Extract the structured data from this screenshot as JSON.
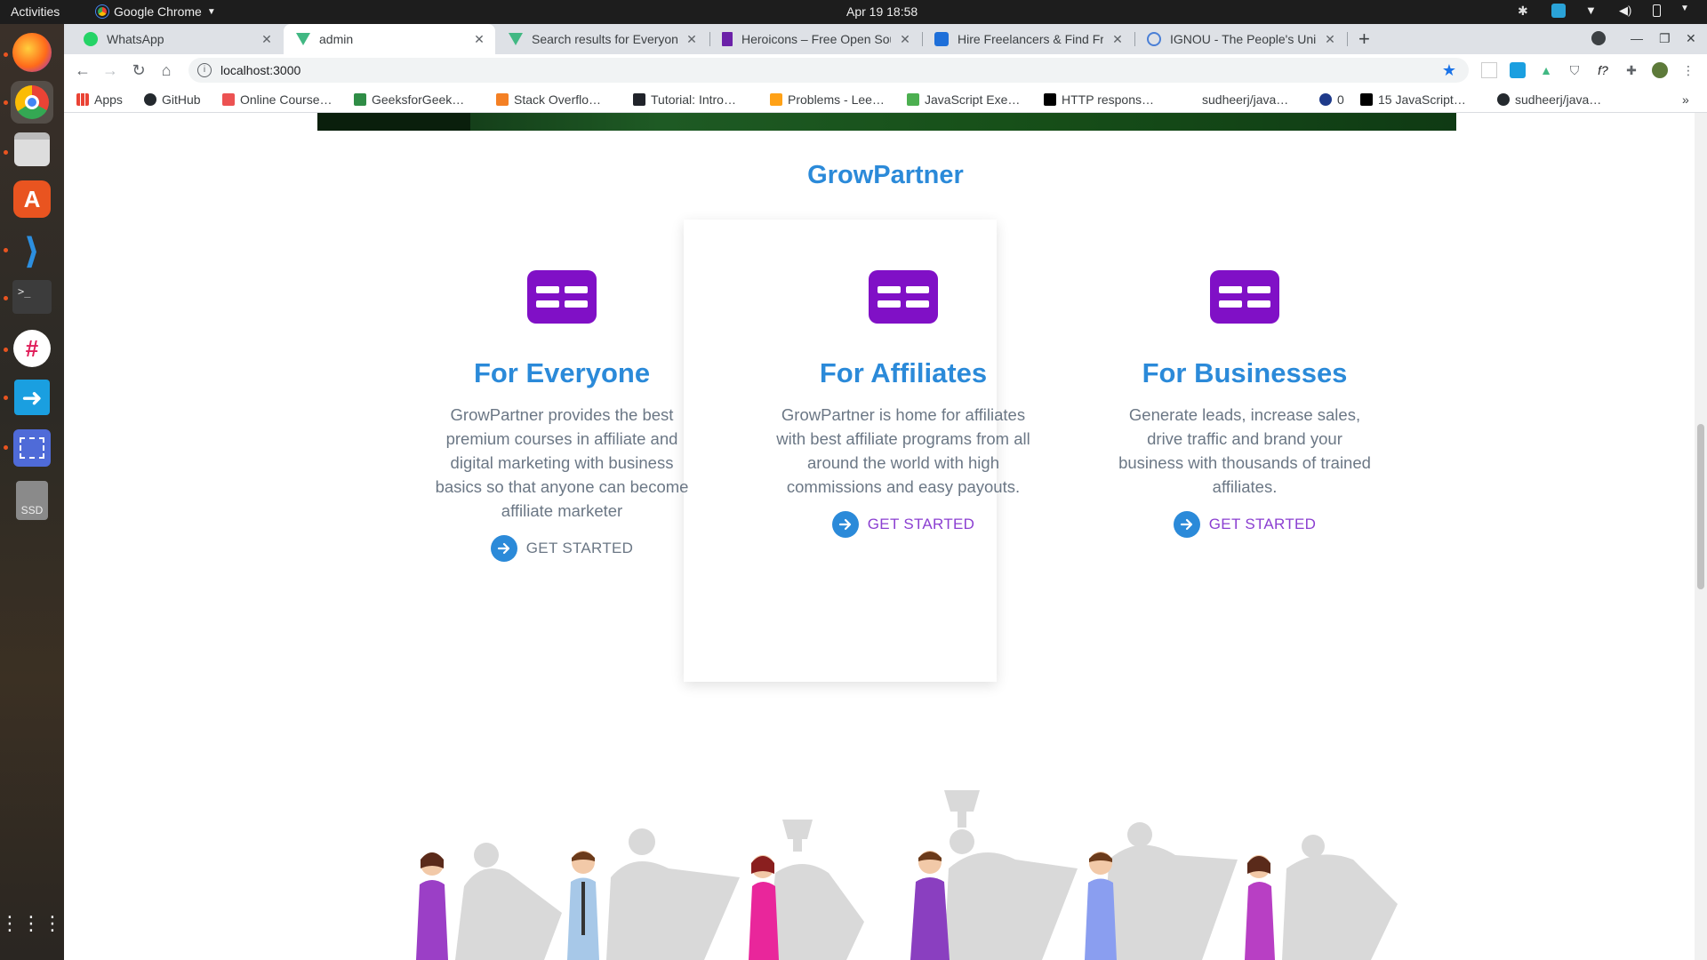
{
  "system": {
    "activities": "Activities",
    "app_name": "Google Chrome",
    "clock": "Apr 19  18:58"
  },
  "tabs": [
    {
      "label": "WhatsApp",
      "icon": "whatsapp-icon",
      "color": "#25d366"
    },
    {
      "label": "admin",
      "icon": "vue-icon",
      "color": "#41b883"
    },
    {
      "label": "Search results for Everyone",
      "icon": "vue-icon",
      "color": "#41b883"
    },
    {
      "label": "Heroicons – Free Open Source",
      "icon": "flag-icon",
      "color": "#6b21a8"
    },
    {
      "label": "Hire Freelancers & Find Freelance",
      "icon": "freelancer-icon",
      "color": "#1e6fd9"
    },
    {
      "label": "IGNOU - The People's University",
      "icon": "globe-icon",
      "color": "#4a7fd6"
    }
  ],
  "omnibox": {
    "url": "localhost:3000"
  },
  "bookmarks": [
    {
      "label": "Apps",
      "icon": "apps-grid-icon"
    },
    {
      "label": "GitHub",
      "icon": "github-icon"
    },
    {
      "label": "Online Course…",
      "icon": "udemy-icon"
    },
    {
      "label": "GeeksforGeek…",
      "icon": "gfg-icon"
    },
    {
      "label": "Stack Overflo…",
      "icon": "stackoverflow-icon"
    },
    {
      "label": "Tutorial: Intro…",
      "icon": "react-icon"
    },
    {
      "label": "Problems - Lee…",
      "icon": "leetcode-icon"
    },
    {
      "label": "JavaScript Exe…",
      "icon": "w3-icon"
    },
    {
      "label": "HTTP respons…",
      "icon": "mdn-icon"
    },
    {
      "label": "sudheerj/java…",
      "icon": "blank-icon"
    },
    {
      "label": "0",
      "icon": "moon-icon"
    },
    {
      "label": "15 JavaScript…",
      "icon": "dev-icon"
    },
    {
      "label": "sudheerj/java…",
      "icon": "github-icon"
    }
  ],
  "page": {
    "section_title": "GrowPartner",
    "features": [
      {
        "title": "For Everyone",
        "description": "GrowPartner provides the best premium courses in affiliate and digital marketing with business basics so that anyone can become affiliate marketer",
        "cta": "GET STARTED",
        "cta_color": "#6b7785"
      },
      {
        "title": "For Affiliates",
        "description": "GrowPartner is home for affiliates with best affiliate programs from all around the world with high commissions and easy payouts.",
        "cta": "GET STARTED",
        "cta_color": "#8b3fd1"
      },
      {
        "title": "For Businesses",
        "description": "Generate leads, increase sales, drive traffic and brand your business with thousands of trained affiliates.",
        "cta": "GET STARTED",
        "cta_color": "#8b3fd1"
      }
    ]
  },
  "colors": {
    "accent_blue": "#2b8ad9",
    "icon_purple": "#8010c6",
    "text_gray": "#6b7785"
  }
}
